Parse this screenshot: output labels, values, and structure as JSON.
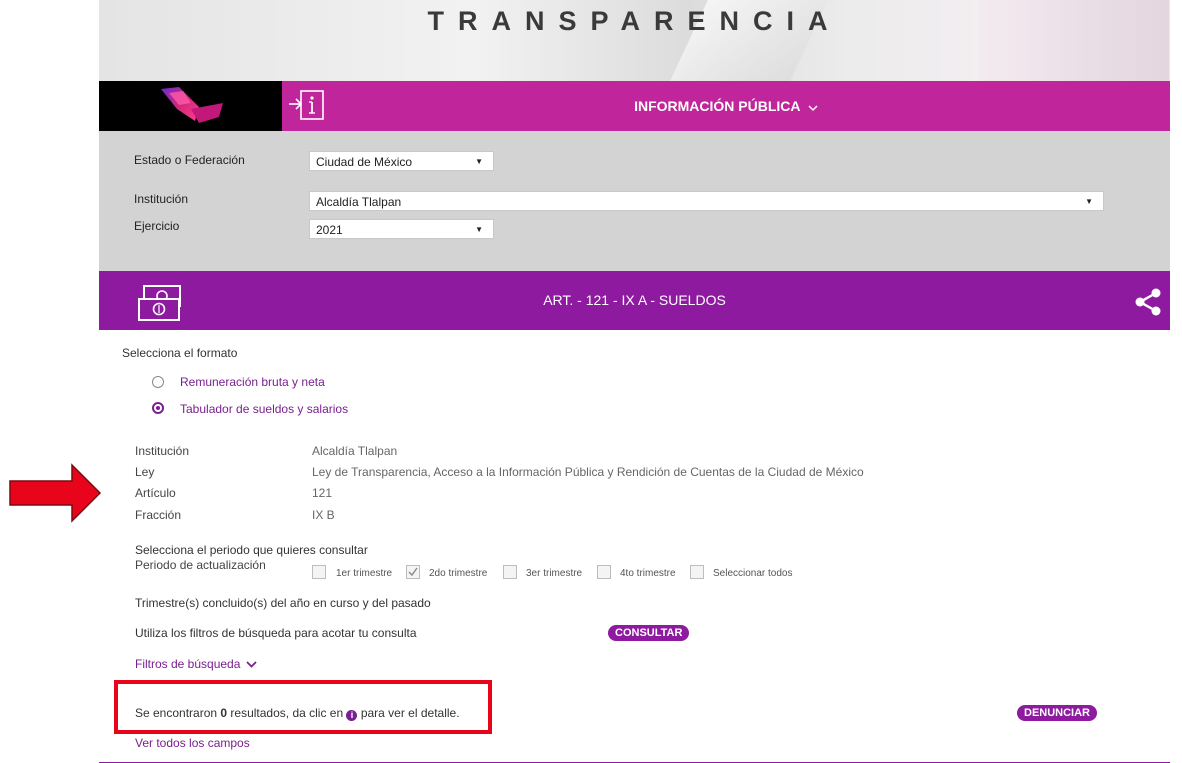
{
  "banner": {
    "title": "TRANSPARENCIA"
  },
  "topbar": {
    "menu_label": "INFORMACIÓN PÚBLICA",
    "menu_icon": "chevron-down-icon",
    "accent": "#c0259b"
  },
  "filters": {
    "state_label": "Estado o Federación",
    "state_value": "Ciudad de México",
    "institution_label": "Institución",
    "institution_value": "Alcaldía Tlalpan",
    "year_label": "Ejercicio",
    "year_value": "2021"
  },
  "section": {
    "title": "ART. - 121 - IX A - SUELDOS",
    "icon": "money-bills-icon",
    "share_icon": "share-icon",
    "color": "#8e1aa0"
  },
  "format": {
    "prompt": "Selecciona el formato",
    "options": [
      {
        "label": "Remuneración bruta y neta",
        "selected": false
      },
      {
        "label": "Tabulador de sueldos y salarios",
        "selected": true
      }
    ]
  },
  "details": {
    "rows": [
      {
        "label": "Institución",
        "value": "Alcaldía Tlalpan"
      },
      {
        "label": "Ley",
        "value": "Ley de Transparencia, Acceso a la Información Pública y Rendición de Cuentas de la Ciudad de México"
      },
      {
        "label": "Artículo",
        "value": "121"
      },
      {
        "label": "Fracción",
        "value": "IX B"
      }
    ]
  },
  "period": {
    "prompt": "Selecciona el periodo que quieres consultar",
    "label": "Periodo de actualización",
    "options": [
      {
        "label": "1er trimestre",
        "checked": false
      },
      {
        "label": "2do trimestre",
        "checked": true
      },
      {
        "label": "3er trimestre",
        "checked": false
      },
      {
        "label": "4to trimestre",
        "checked": false
      },
      {
        "label": "Seleccionar todos",
        "checked": false
      }
    ],
    "note": "Trimestre(s) concluido(s) del año en curso y del pasado"
  },
  "consult": {
    "hint": "Utiliza los filtros de búsqueda para acotar tu consulta",
    "button": "CONSULTAR"
  },
  "search_filters": {
    "label": "Filtros de búsqueda"
  },
  "results": {
    "prefix": "Se encontraron ",
    "count": "0",
    "middle": " resultados, da clic en ",
    "suffix": " para ver el detalle.",
    "info_icon": "info-circle-icon"
  },
  "report": {
    "button": "DENUNCIAR"
  },
  "view_all": {
    "label": "Ver todos los campos"
  },
  "annotations": {
    "arrow_color": "#e8051b",
    "box_color": "#e8051b"
  }
}
